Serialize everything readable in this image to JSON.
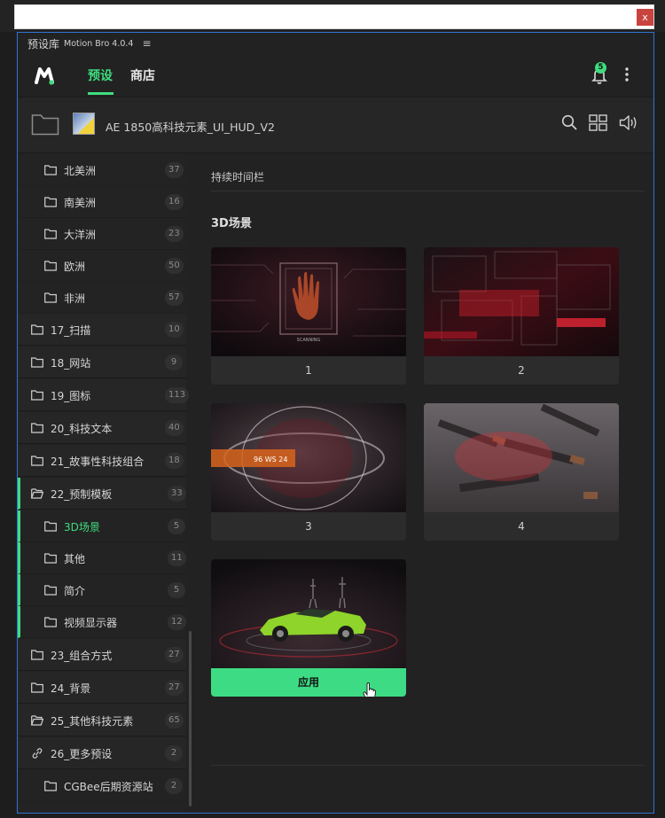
{
  "window": {
    "close_label": "x"
  },
  "panel": {
    "title": "预设库",
    "app_name": "Motion Bro 4.0.4",
    "menu_glyph": "≡"
  },
  "nav": {
    "tab_presets": "预设",
    "tab_store": "商店",
    "notification_count": "5"
  },
  "path": {
    "title": "AE 1850高科技元素_UI_HUD_V2"
  },
  "sidebar": {
    "items": [
      {
        "label": "北美洲",
        "count": "37"
      },
      {
        "label": "南美洲",
        "count": "16"
      },
      {
        "label": "大洋洲",
        "count": "23"
      },
      {
        "label": "欧洲",
        "count": "50"
      },
      {
        "label": "非洲",
        "count": "57"
      },
      {
        "label": "17_扫描",
        "count": "10"
      },
      {
        "label": "18_网站",
        "count": "9"
      },
      {
        "label": "19_图标",
        "count": "113"
      },
      {
        "label": "20_科技文本",
        "count": "40"
      },
      {
        "label": "21_故事性科技组合",
        "count": "18"
      },
      {
        "label": "22_预制模板",
        "count": "33"
      },
      {
        "label": "3D场景",
        "count": "5"
      },
      {
        "label": "其他",
        "count": "11"
      },
      {
        "label": "简介",
        "count": "5"
      },
      {
        "label": "视频显示器",
        "count": "12"
      },
      {
        "label": "23_组合方式",
        "count": "27"
      },
      {
        "label": "24_背景",
        "count": "27"
      },
      {
        "label": "25_其他科技元素",
        "count": "65"
      },
      {
        "label": "26_更多预设",
        "count": "2"
      },
      {
        "label": "CGBee后期资源站",
        "count": "2"
      }
    ]
  },
  "content": {
    "category_label": "持续时间栏",
    "section_title": "3D场景",
    "cards": [
      {
        "caption": "1"
      },
      {
        "caption": "2"
      },
      {
        "caption": "3"
      },
      {
        "caption": "4"
      },
      {
        "caption": "应用"
      }
    ],
    "card3_overlay": "96 WS  24"
  },
  "colors": {
    "accent": "#3fdc7f",
    "panel_border": "#2f73d6",
    "close": "#c9443f"
  }
}
